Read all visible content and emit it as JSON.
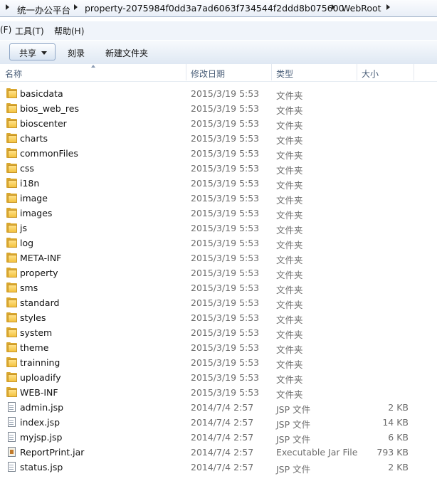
{
  "addressbar": {
    "crumbs": [
      "统一办公平台",
      "property-2075984f0dd3a7ad6063f734544f2ddd8b075600",
      "WebRoot"
    ]
  },
  "menubar": {
    "items": [
      "(F)",
      "工具(T)",
      "帮助(H)"
    ]
  },
  "toolbar": {
    "share_label": "共享",
    "burn_label": "刻录",
    "new_folder_label": "新建文件夹"
  },
  "columns": {
    "name": "名称",
    "modified": "修改日期",
    "type": "类型",
    "size": "大小"
  },
  "files": [
    {
      "name": "basicdata",
      "modified": "2015/3/19 5:53",
      "type": "文件夹",
      "size": "",
      "kind": "folder"
    },
    {
      "name": "bios_web_res",
      "modified": "2015/3/19 5:53",
      "type": "文件夹",
      "size": "",
      "kind": "folder"
    },
    {
      "name": "bioscenter",
      "modified": "2015/3/19 5:53",
      "type": "文件夹",
      "size": "",
      "kind": "folder"
    },
    {
      "name": "charts",
      "modified": "2015/3/19 5:53",
      "type": "文件夹",
      "size": "",
      "kind": "folder"
    },
    {
      "name": "commonFiles",
      "modified": "2015/3/19 5:53",
      "type": "文件夹",
      "size": "",
      "kind": "folder"
    },
    {
      "name": "css",
      "modified": "2015/3/19 5:53",
      "type": "文件夹",
      "size": "",
      "kind": "folder"
    },
    {
      "name": "i18n",
      "modified": "2015/3/19 5:53",
      "type": "文件夹",
      "size": "",
      "kind": "folder"
    },
    {
      "name": "image",
      "modified": "2015/3/19 5:53",
      "type": "文件夹",
      "size": "",
      "kind": "folder"
    },
    {
      "name": "images",
      "modified": "2015/3/19 5:53",
      "type": "文件夹",
      "size": "",
      "kind": "folder"
    },
    {
      "name": "js",
      "modified": "2015/3/19 5:53",
      "type": "文件夹",
      "size": "",
      "kind": "folder"
    },
    {
      "name": "log",
      "modified": "2015/3/19 5:53",
      "type": "文件夹",
      "size": "",
      "kind": "folder"
    },
    {
      "name": "META-INF",
      "modified": "2015/3/19 5:53",
      "type": "文件夹",
      "size": "",
      "kind": "folder"
    },
    {
      "name": "property",
      "modified": "2015/3/19 5:53",
      "type": "文件夹",
      "size": "",
      "kind": "folder"
    },
    {
      "name": "sms",
      "modified": "2015/3/19 5:53",
      "type": "文件夹",
      "size": "",
      "kind": "folder"
    },
    {
      "name": "standard",
      "modified": "2015/3/19 5:53",
      "type": "文件夹",
      "size": "",
      "kind": "folder"
    },
    {
      "name": "styles",
      "modified": "2015/3/19 5:53",
      "type": "文件夹",
      "size": "",
      "kind": "folder"
    },
    {
      "name": "system",
      "modified": "2015/3/19 5:53",
      "type": "文件夹",
      "size": "",
      "kind": "folder"
    },
    {
      "name": "theme",
      "modified": "2015/3/19 5:53",
      "type": "文件夹",
      "size": "",
      "kind": "folder"
    },
    {
      "name": "trainning",
      "modified": "2015/3/19 5:53",
      "type": "文件夹",
      "size": "",
      "kind": "folder"
    },
    {
      "name": "uploadify",
      "modified": "2015/3/19 5:53",
      "type": "文件夹",
      "size": "",
      "kind": "folder"
    },
    {
      "name": "WEB-INF",
      "modified": "2015/3/19 5:53",
      "type": "文件夹",
      "size": "",
      "kind": "folder"
    },
    {
      "name": "admin.jsp",
      "modified": "2014/7/4 2:57",
      "type": "JSP 文件",
      "size": "2 KB",
      "kind": "file"
    },
    {
      "name": "index.jsp",
      "modified": "2014/7/4 2:57",
      "type": "JSP 文件",
      "size": "14 KB",
      "kind": "file"
    },
    {
      "name": "myjsp.jsp",
      "modified": "2014/7/4 2:57",
      "type": "JSP 文件",
      "size": "6 KB",
      "kind": "file"
    },
    {
      "name": "ReportPrint.jar",
      "modified": "2014/7/4 2:57",
      "type": "Executable Jar File",
      "size": "793 KB",
      "kind": "jar"
    },
    {
      "name": "status.jsp",
      "modified": "2014/7/4 2:57",
      "type": "JSP 文件",
      "size": "2 KB",
      "kind": "file"
    }
  ]
}
